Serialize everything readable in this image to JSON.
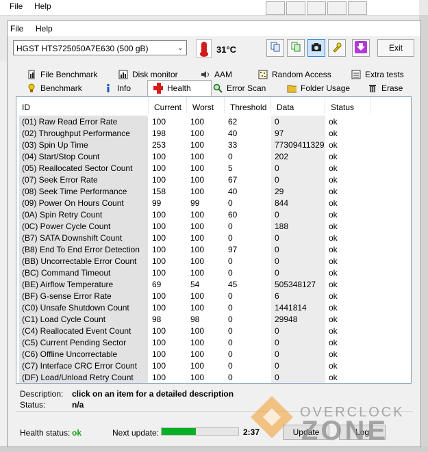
{
  "back_window": {
    "menu": [
      "File",
      "Help"
    ]
  },
  "window": {
    "menu": [
      "File",
      "Help"
    ],
    "drive": "HGST HTS725050A7E630 (500 gB)",
    "temperature": "31°C",
    "exit_label": "Exit",
    "toolbar_icons": [
      "copy-icon",
      "copy-screen-icon",
      "camera-icon",
      "options-icon",
      "download-icon"
    ]
  },
  "tabs_top": [
    {
      "label": "File Benchmark",
      "icon": "file-benchmark-icon"
    },
    {
      "label": "Disk monitor",
      "icon": "disk-monitor-icon"
    },
    {
      "label": "AAM",
      "icon": "speaker-icon"
    },
    {
      "label": "Random Access",
      "icon": "random-access-icon"
    },
    {
      "label": "Extra tests",
      "icon": "extra-tests-icon"
    }
  ],
  "tabs_bottom": [
    {
      "label": "Benchmark",
      "icon": "benchmark-icon"
    },
    {
      "label": "Info",
      "icon": "info-icon"
    },
    {
      "label": "Health",
      "icon": "health-cross-icon"
    },
    {
      "label": "Error Scan",
      "icon": "magnifier-icon"
    },
    {
      "label": "Folder Usage",
      "icon": "folder-icon"
    },
    {
      "label": "Erase",
      "icon": "trash-icon"
    }
  ],
  "table": {
    "headers": [
      "ID",
      "Current",
      "Worst",
      "Threshold",
      "Data",
      "Status"
    ],
    "rows": [
      [
        "(01) Raw Read Error Rate",
        "100",
        "100",
        "62",
        "0",
        "ok"
      ],
      [
        "(02) Throughput Performance",
        "198",
        "100",
        "40",
        "97",
        "ok"
      ],
      [
        "(03) Spin Up Time",
        "253",
        "100",
        "33",
        "77309411329",
        "ok"
      ],
      [
        "(04) Start/Stop Count",
        "100",
        "100",
        "0",
        "202",
        "ok"
      ],
      [
        "(05) Reallocated Sector Count",
        "100",
        "100",
        "5",
        "0",
        "ok"
      ],
      [
        "(07) Seek Error Rate",
        "100",
        "100",
        "67",
        "0",
        "ok"
      ],
      [
        "(08) Seek Time Performance",
        "158",
        "100",
        "40",
        "29",
        "ok"
      ],
      [
        "(09) Power On Hours Count",
        "99",
        "99",
        "0",
        "844",
        "ok"
      ],
      [
        "(0A) Spin Retry Count",
        "100",
        "100",
        "60",
        "0",
        "ok"
      ],
      [
        "(0C) Power Cycle Count",
        "100",
        "100",
        "0",
        "188",
        "ok"
      ],
      [
        "(B7) SATA Downshift Count",
        "100",
        "100",
        "0",
        "0",
        "ok"
      ],
      [
        "(B8) End To End Error Detection",
        "100",
        "100",
        "97",
        "0",
        "ok"
      ],
      [
        "(BB) Uncorrectable Error Count",
        "100",
        "100",
        "0",
        "0",
        "ok"
      ],
      [
        "(BC) Command Timeout",
        "100",
        "100",
        "0",
        "0",
        "ok"
      ],
      [
        "(BE) Airflow Temperature",
        "69",
        "54",
        "45",
        "505348127",
        "ok"
      ],
      [
        "(BF) G-sense Error Rate",
        "100",
        "100",
        "0",
        "6",
        "ok"
      ],
      [
        "(C0) Unsafe Shutdown Count",
        "100",
        "100",
        "0",
        "1441814",
        "ok"
      ],
      [
        "(C1) Load Cycle Count",
        "98",
        "98",
        "0",
        "29948",
        "ok"
      ],
      [
        "(C4) Reallocated Event Count",
        "100",
        "100",
        "0",
        "0",
        "ok"
      ],
      [
        "(C5) Current Pending Sector",
        "100",
        "100",
        "0",
        "0",
        "ok"
      ],
      [
        "(C6) Offline Uncorrectable",
        "100",
        "100",
        "0",
        "0",
        "ok"
      ],
      [
        "(C7) Interface CRC Error Count",
        "100",
        "100",
        "0",
        "0",
        "ok"
      ],
      [
        "(DF) Load/Unload Retry Count",
        "100",
        "100",
        "0",
        "0",
        "ok"
      ]
    ]
  },
  "description": {
    "label": "Description:",
    "value": "click on an item for a detailed description",
    "status_label": "Status:",
    "status_value": "n/a"
  },
  "health": {
    "label": "Health status:",
    "value": "ok",
    "next_update_label": "Next update:",
    "progress_fraction": 0.45,
    "time": "2:37",
    "update_label": "Update",
    "log_label": "Log"
  },
  "watermark": {
    "top": "OVERCLOCK",
    "bottom": "ZONE"
  },
  "colors": {
    "ok_green": "#1aa31a",
    "progress_green": "#06b025",
    "selection_blue": "#cfe5fb"
  }
}
